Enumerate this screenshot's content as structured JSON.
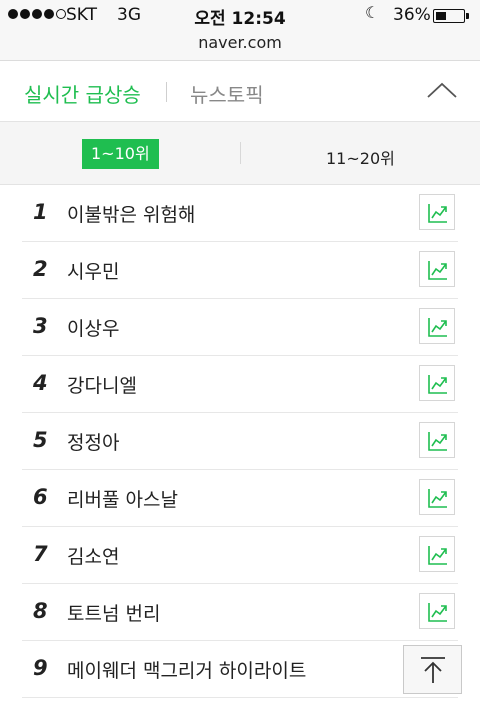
{
  "status_bar": {
    "carrier": "SKT",
    "network": "3G",
    "time": "오전 12:54",
    "battery_percent": "36%",
    "battery_level": 0.36,
    "signal_bars": 4
  },
  "browser": {
    "url": "naver.com"
  },
  "header": {
    "tab_realtime": "실시간 급상승",
    "tab_news": "뉴스토픽"
  },
  "ranges": {
    "active": "1~10위",
    "inactive": "11~20위"
  },
  "ranking": [
    {
      "rank": "1",
      "keyword": "이불밖은 위험해"
    },
    {
      "rank": "2",
      "keyword": "시우민"
    },
    {
      "rank": "3",
      "keyword": "이상우"
    },
    {
      "rank": "4",
      "keyword": "강다니엘"
    },
    {
      "rank": "5",
      "keyword": "정정아"
    },
    {
      "rank": "6",
      "keyword": "리버풀 아스날"
    },
    {
      "rank": "7",
      "keyword": "김소연"
    },
    {
      "rank": "8",
      "keyword": "토트넘 번리"
    },
    {
      "rank": "9",
      "keyword": "메이웨더 맥그리거 하이라이트"
    }
  ],
  "colors": {
    "accent": "#1fbe50",
    "text": "#222222",
    "muted": "#888888",
    "divider": "#e7e7e7"
  },
  "icons": {
    "trend": "trend-chart-icon",
    "collapse": "chevron-up-icon",
    "scroll_top": "arrow-up-icon"
  }
}
